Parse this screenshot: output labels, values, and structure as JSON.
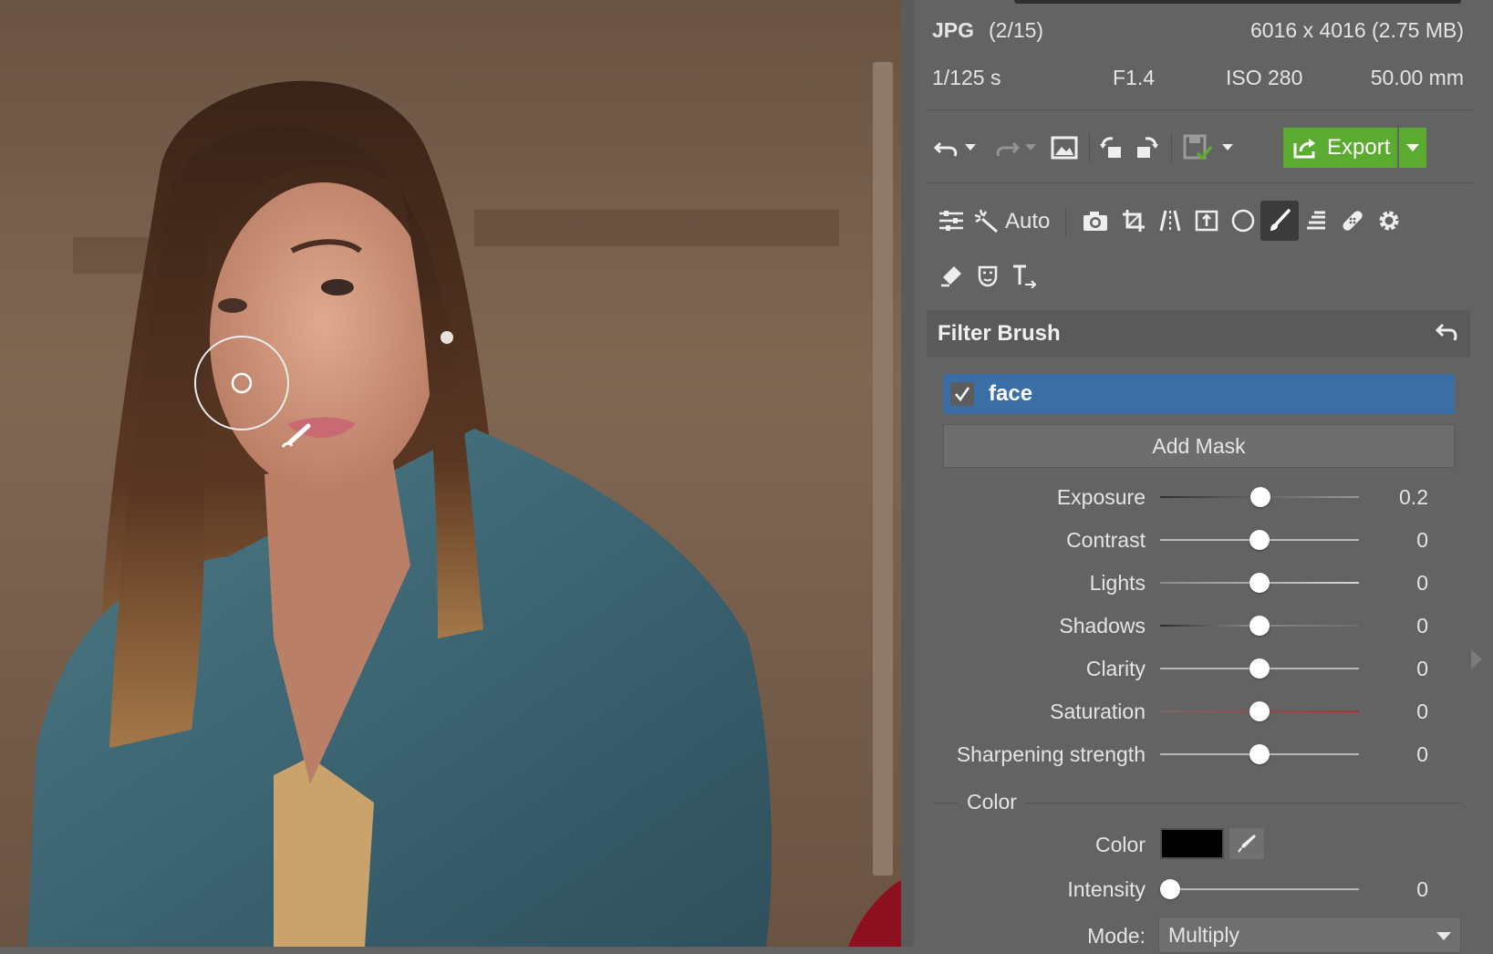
{
  "file_info": {
    "format": "JPG",
    "index": "(2/15)",
    "dimensions": "6016 x 4016 (2.75 MB)",
    "shutter": "1/125 s",
    "aperture": "F1.4",
    "iso": "ISO 280",
    "focal_length": "50.00 mm"
  },
  "toolbar": {
    "export_label": "Export",
    "icons": [
      "undo-icon",
      "undo-dropdown-icon",
      "redo-icon",
      "redo-dropdown-icon",
      "image-icon",
      "rotate-left-icon",
      "rotate-right-icon",
      "save-icon",
      "save-dropdown-icon",
      "export-icon",
      "export-dropdown-icon"
    ]
  },
  "tools": {
    "auto_label": "Auto",
    "active_tool": "brush-tool-icon"
  },
  "filter_brush": {
    "title": "Filter Brush",
    "mask": {
      "name": "face",
      "checked": true
    },
    "add_mask_label": "Add Mask",
    "sliders": [
      {
        "label": "Exposure",
        "value": "0.2",
        "position": 0.51
      },
      {
        "label": "Contrast",
        "value": "0",
        "position": 0.5
      },
      {
        "label": "Lights",
        "value": "0",
        "position": 0.5
      },
      {
        "label": "Shadows",
        "value": "0",
        "position": 0.5
      },
      {
        "label": "Clarity",
        "value": "0",
        "position": 0.5
      },
      {
        "label": "Saturation",
        "value": "0",
        "position": 0.5
      },
      {
        "label": "Sharpening strength",
        "value": "0",
        "position": 0.5
      }
    ],
    "color_group_title": "Color",
    "color_label": "Color",
    "color_value": "#000000",
    "intensity_label": "Intensity",
    "intensity_value": "0",
    "intensity_position": 0.0,
    "mode_label": "Mode:",
    "mode_value": "Multiply"
  },
  "colors": {
    "panel_bg": "#636363",
    "selection_blue": "#3a6ea5",
    "export_green": "#5aab2f"
  }
}
